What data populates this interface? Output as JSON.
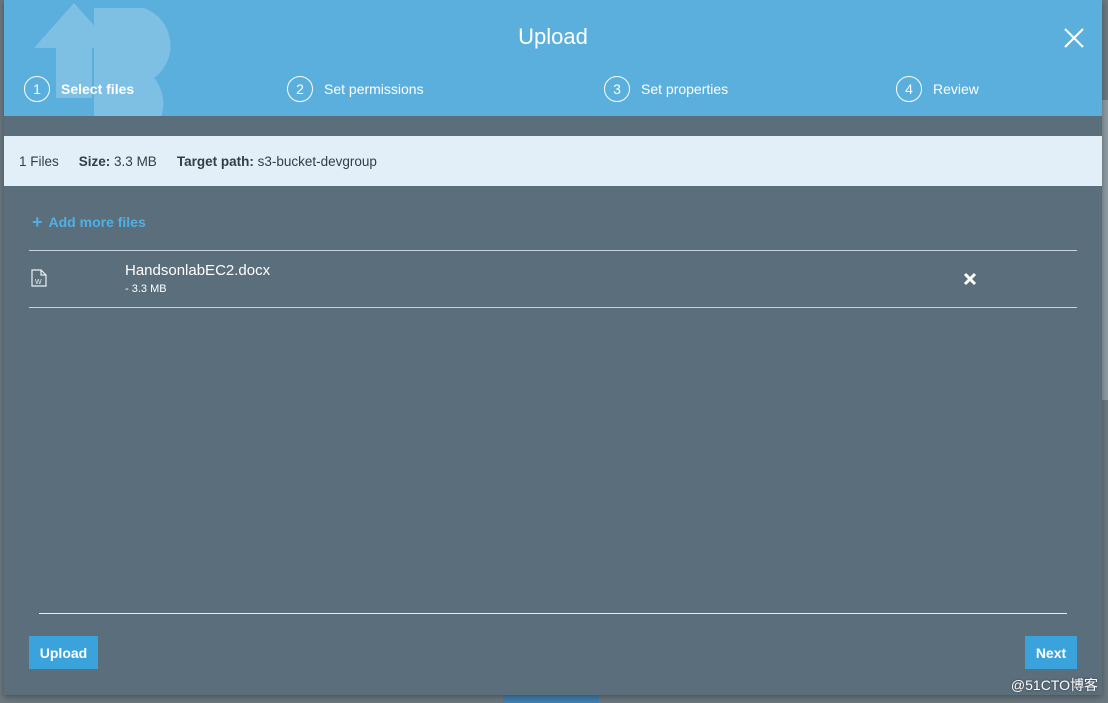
{
  "modal": {
    "title": "Upload",
    "steps": [
      {
        "num": "1",
        "label": "Select files",
        "active": true
      },
      {
        "num": "2",
        "label": "Set permissions",
        "active": false
      },
      {
        "num": "3",
        "label": "Set properties",
        "active": false
      },
      {
        "num": "4",
        "label": "Review",
        "active": false
      }
    ]
  },
  "info": {
    "files_count": "1 Files",
    "size_label": "Size:",
    "size_value": "3.3 MB",
    "target_label": "Target path:",
    "target_value": "s3-bucket-devgroup"
  },
  "add_more": {
    "icon": "plus-icon",
    "label": "Add more files"
  },
  "files": [
    {
      "name": "HandsonlabEC2.docx",
      "size": "- 3.3 MB",
      "icon": "word-document-icon"
    }
  ],
  "footer": {
    "upload_label": "Upload",
    "next_label": "Next"
  },
  "watermark": "@51CTO博客",
  "colors": {
    "header": "#5aafdc",
    "body": "#5b6e7c",
    "info_bar": "#e2eff8",
    "accent": "#3aa3dc",
    "link": "#4fb0e6"
  }
}
